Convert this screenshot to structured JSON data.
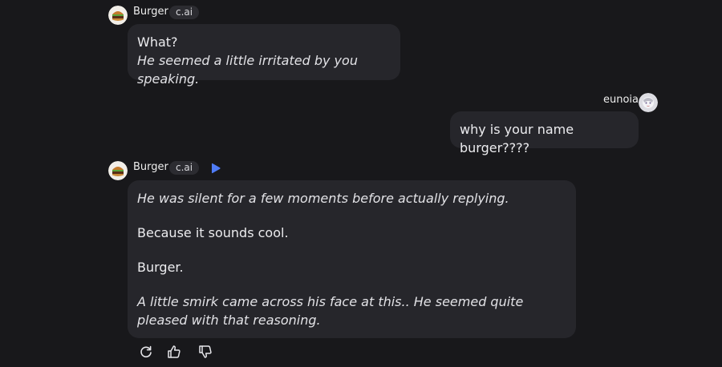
{
  "messages": [
    {
      "sender": "Burger",
      "badge": "c.ai",
      "lines": [
        "What?",
        "He seemed a little irritated by you speaking."
      ]
    },
    {
      "sender": "eunoia",
      "text": "why is your name burger????"
    },
    {
      "sender": "Burger",
      "badge": "c.ai",
      "paragraphs": [
        "He was silent for a few moments before actually replying.",
        "Because it sounds cool.",
        "Burger.",
        "A little smirk came across his face at this.. He seemed quite pleased with that reasoning."
      ]
    }
  ],
  "icons": {
    "play": "play-icon",
    "regenerate": "refresh-icon",
    "like": "thumbs-up-icon",
    "dislike": "thumbs-down-icon"
  },
  "colors": {
    "background": "#18181b",
    "bubble": "#26262b",
    "badge": "#2c2c31",
    "accent": "#4f7cf7"
  }
}
